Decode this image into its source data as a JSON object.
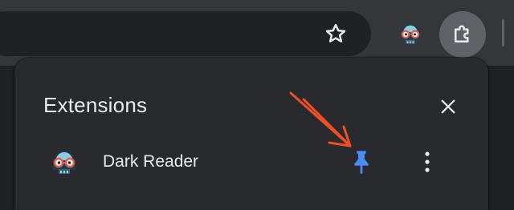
{
  "toolbar": {
    "bookmark_icon": "star-outline-icon",
    "dark_reader_icon": "dark-reader-icon",
    "extensions_icon": "puzzle-piece-icon"
  },
  "popup": {
    "title": "Extensions",
    "close_icon": "close-icon",
    "extensions": [
      {
        "name": "Dark Reader",
        "icon": "dark-reader-icon",
        "pinned": true,
        "pin_icon": "pin-icon",
        "more_icon": "more-vert-icon"
      }
    ]
  },
  "annotation": {
    "type": "arrow",
    "target": "pin-button",
    "color": "#f04e23"
  },
  "colors": {
    "toolbar_bg": "#35363a",
    "omnibox_bg": "#202124",
    "popup_bg": "#292a2d",
    "text": "#e8eaed",
    "icon": "#e8eaed",
    "pin_blue": "#4c8bf5",
    "active_button_bg": "#5f6368"
  }
}
